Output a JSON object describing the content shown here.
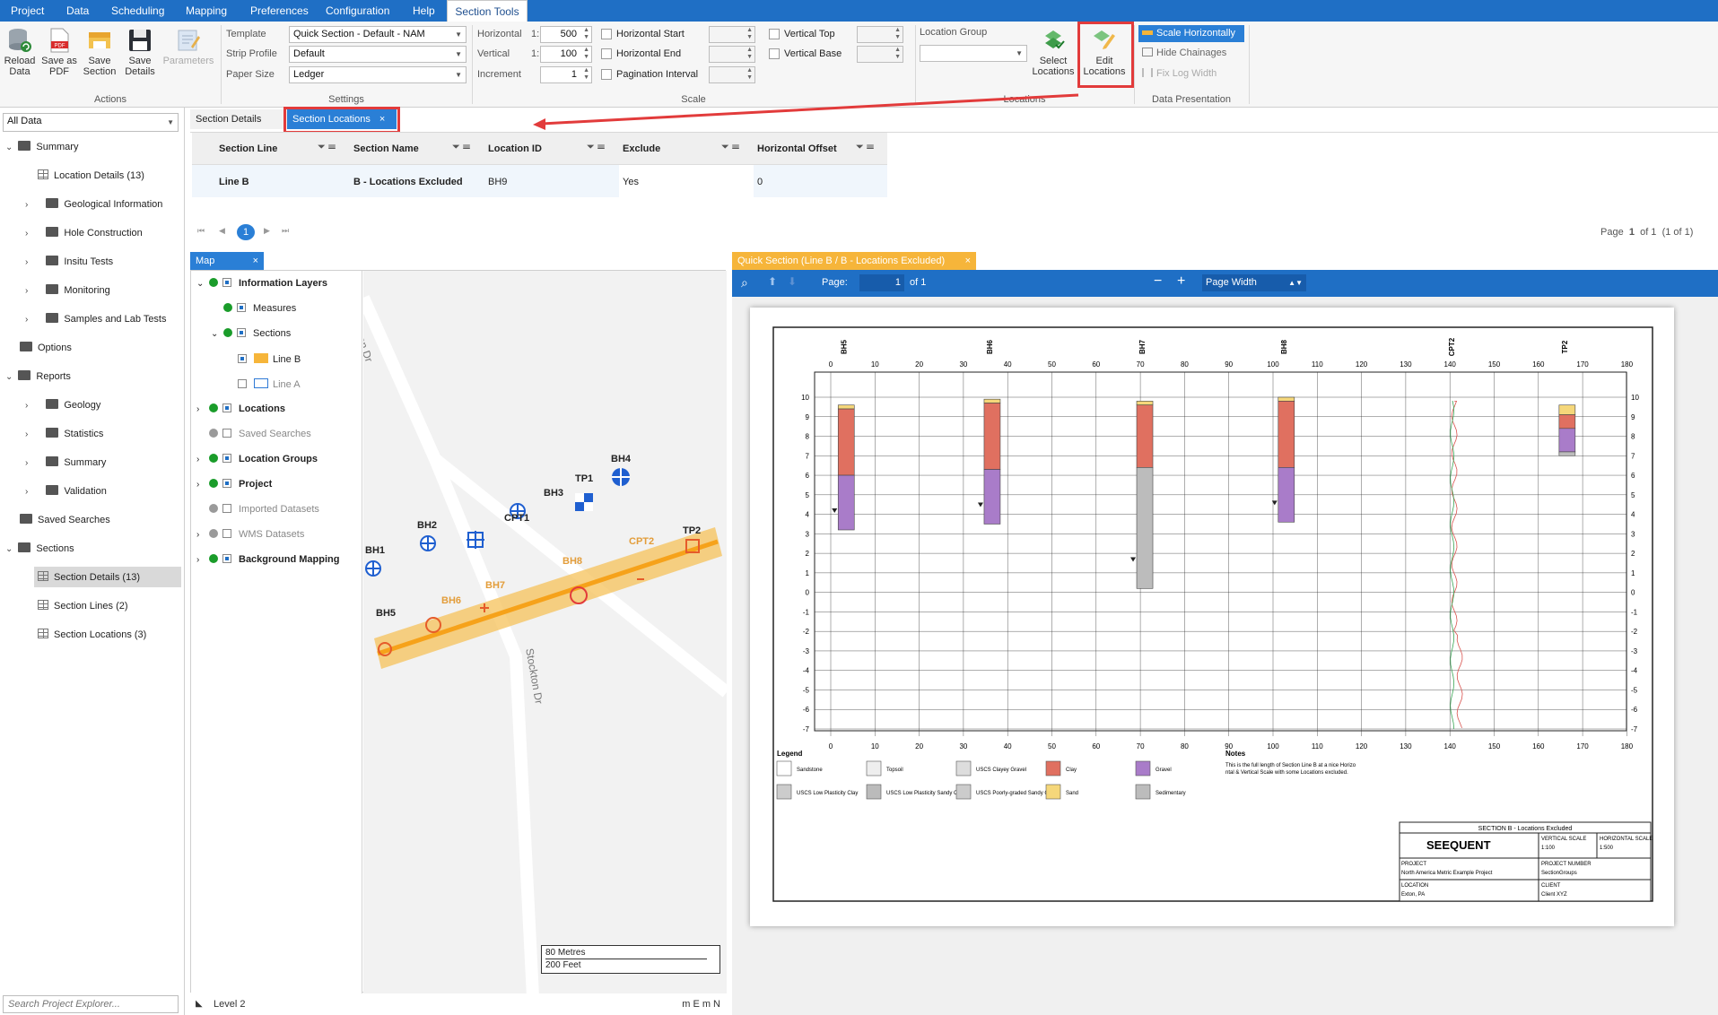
{
  "menu": [
    "Project",
    "Data",
    "Scheduling",
    "Mapping",
    "Preferences",
    "Configuration",
    "Help",
    "Section Tools"
  ],
  "ribbon": {
    "actions": {
      "reload": "Reload Data",
      "save_pdf": "Save as PDF",
      "save_section": "Save Section",
      "save_details": "Save Details",
      "parameters": "Parameters",
      "group": "Actions"
    },
    "settings": {
      "template_label": "Template",
      "template_value": "Quick Section - Default - NAM",
      "strip_label": "Strip Profile",
      "strip_value": "Default",
      "paper_label": "Paper Size",
      "paper_value": "Ledger",
      "group": "Settings"
    },
    "scale": {
      "horizontal_label": "Horizontal",
      "horizontal_value": "500",
      "vertical_label": "Vertical",
      "vertical_value": "100",
      "increment_label": "Increment",
      "increment_value": "1",
      "ratio_prefix": "1:",
      "h_start": "Horizontal Start",
      "h_end": "Horizontal End",
      "pagination": "Pagination Interval",
      "v_top": "Vertical Top",
      "v_base": "Vertical Base",
      "group": "Scale"
    },
    "locations": {
      "group_label": "Location Group",
      "select": "Select Locations",
      "edit": "Edit Locations",
      "group": "Locations"
    },
    "presentation": {
      "scale_h": "Scale Horizontally",
      "hide_chainages": "Hide Chainages",
      "fix_log": "Fix Log Width",
      "group": "Data Presentation"
    }
  },
  "explorer": {
    "dropdown": "All Data",
    "search_placeholder": "Search Project Explorer...",
    "items": [
      {
        "label": "Summary",
        "type": "folder",
        "level": 0,
        "exp": "v"
      },
      {
        "label": "Location Details (13)",
        "type": "grid",
        "level": 1,
        "exp": ""
      },
      {
        "label": "Geological Information",
        "type": "folder",
        "level": 1,
        "exp": ">"
      },
      {
        "label": "Hole Construction",
        "type": "folder",
        "level": 1,
        "exp": ">"
      },
      {
        "label": "Insitu Tests",
        "type": "folder",
        "level": 1,
        "exp": ">"
      },
      {
        "label": "Monitoring",
        "type": "folder",
        "level": 1,
        "exp": ">"
      },
      {
        "label": "Samples and Lab Tests",
        "type": "folder",
        "level": 1,
        "exp": ">"
      },
      {
        "label": "Options",
        "type": "folder",
        "level": 0,
        "exp": ""
      },
      {
        "label": "Reports",
        "type": "folder",
        "level": 0,
        "exp": "v"
      },
      {
        "label": "Geology",
        "type": "folder",
        "level": 1,
        "exp": ">"
      },
      {
        "label": "Statistics",
        "type": "folder",
        "level": 1,
        "exp": ">"
      },
      {
        "label": "Summary",
        "type": "folder",
        "level": 1,
        "exp": ">"
      },
      {
        "label": "Validation",
        "type": "folder",
        "level": 1,
        "exp": ">"
      },
      {
        "label": "Saved Searches",
        "type": "folder",
        "level": 0,
        "exp": ""
      },
      {
        "label": "Sections",
        "type": "folder",
        "level": 0,
        "exp": "v"
      },
      {
        "label": "Section Details (13)",
        "type": "grid",
        "level": 1,
        "exp": "",
        "selected": true
      },
      {
        "label": "Section Lines (2)",
        "type": "grid",
        "level": 1,
        "exp": ""
      },
      {
        "label": "Section Locations (3)",
        "type": "grid",
        "level": 1,
        "exp": ""
      }
    ]
  },
  "tabs": {
    "details": "Section Details",
    "locations": "Section Locations"
  },
  "grid": {
    "headers": [
      "Section Line",
      "Section Name",
      "Location ID",
      "Exclude",
      "Horizontal Offset"
    ],
    "row": [
      "Line B",
      "B - Locations Excluded",
      "BH9",
      "Yes",
      "0"
    ],
    "pager_page": "1",
    "page_label": "Page",
    "page_num": "1",
    "page_of": "of 1",
    "page_count": "(1 of 1)"
  },
  "map": {
    "tab": "Map",
    "layers": [
      {
        "label": "Information Layers",
        "bold": true,
        "dot": "#1a9c2a",
        "exp": "v",
        "indent": 0,
        "check": true
      },
      {
        "label": "Measures",
        "bold": false,
        "dot": "#1a9c2a",
        "exp": "",
        "indent": 1,
        "check": true
      },
      {
        "label": "Sections",
        "bold": false,
        "dot": "#1a9c2a",
        "exp": "v",
        "indent": 1,
        "check": true
      },
      {
        "label": "Line B",
        "bold": false,
        "dot": "",
        "exp": "",
        "indent": 2,
        "check": true,
        "swatch": "#f6b53a"
      },
      {
        "label": "Line A",
        "bold": false,
        "dot": "",
        "exp": "",
        "indent": 2,
        "check": false,
        "swatch": "#2f7ad6",
        "gray": true
      },
      {
        "label": "Locations",
        "bold": true,
        "dot": "#1a9c2a",
        "exp": ">",
        "indent": 0,
        "check": true
      },
      {
        "label": "Saved Searches",
        "bold": false,
        "dot": "#9a9a9a",
        "exp": "",
        "indent": 0,
        "check": false,
        "gray": true
      },
      {
        "label": "Location Groups",
        "bold": true,
        "dot": "#1a9c2a",
        "exp": ">",
        "indent": 0,
        "check": true
      },
      {
        "label": "Project",
        "bold": true,
        "dot": "#1a9c2a",
        "exp": ">",
        "indent": 0,
        "check": true
      },
      {
        "label": "Imported Datasets",
        "bold": false,
        "dot": "#9a9a9a",
        "exp": "",
        "indent": 0,
        "check": false,
        "gray": true
      },
      {
        "label": "WMS Datasets",
        "bold": false,
        "dot": "#9a9a9a",
        "exp": ">",
        "indent": 0,
        "check": false,
        "gray": true
      },
      {
        "label": "Background Mapping",
        "bold": true,
        "dot": "#1a9c2a",
        "exp": ">",
        "indent": 0,
        "check": true
      }
    ],
    "road": "Stockton Dr",
    "points": [
      "BH1",
      "BH2",
      "CPT1",
      "BH3",
      "TP1",
      "BH4",
      "TP2",
      "CPT2",
      "BH8",
      "BH7",
      "BH6",
      "BH5"
    ],
    "scale1": "80 Metres",
    "scale2": "200 Feet",
    "status": "Level 2",
    "units": "m E m N"
  },
  "section_view": {
    "tab": "Quick Section (Line B / B - Locations Excluded)",
    "page_label": "Page:",
    "page_value": "1",
    "page_of": "of 1",
    "zoom": "Page Width",
    "x_ticks": [
      "0",
      "10",
      "20",
      "30",
      "40",
      "50",
      "60",
      "70",
      "80",
      "90",
      "100",
      "110",
      "120",
      "130",
      "140",
      "150",
      "160",
      "170",
      "180"
    ],
    "y_ticks": [
      "10",
      "9",
      "8",
      "7",
      "6",
      "5",
      "4",
      "3",
      "2",
      "1",
      "0",
      "-1",
      "-2",
      "-3",
      "-4",
      "-5",
      "-6",
      "-7"
    ],
    "boreholes": [
      "BH5",
      "BH6",
      "BH7",
      "BH8",
      "CPT2",
      "TP2"
    ],
    "legend_title": "Legend",
    "legend": [
      "Sandstone",
      "Topsoil",
      "USCS Clayey Gravel",
      "Clay",
      "Gravel",
      "USCS Low Plasticity Clay",
      "USCS Low Plasticity Sandy Clay",
      "USCS Poorly-graded Sandy Gravel",
      "Sand",
      "Sedimentary"
    ],
    "notes_title": "Notes",
    "notes": "This is the full length of Section Line B at a nice Horizontal & Vertical Scale with some Locations excluded.",
    "titleblock": {
      "title": "SECTION B - Locations Excluded",
      "logo": "SEEQUENT",
      "vs_label": "VERTICAL SCALE",
      "vs": "1:100",
      "hs_label": "HORIZONTAL SCALE",
      "hs": "1:500",
      "project_label": "PROJECT",
      "project": "North America Metric Example Project",
      "pn_label": "PROJECT NUMBER",
      "pn": "SectionGroups",
      "loc_label": "LOCATION",
      "loc": "Exton, PA",
      "client_label": "CLIENT",
      "client": "Client XYZ"
    }
  },
  "colors": {
    "accent": "#1f6fc5",
    "highlight": "#e23b3b",
    "orange": "#f6b53a",
    "clay": "#e07060",
    "gravel": "#a97cc9",
    "sed": "#bcbcbc",
    "sand": "#f5d77a"
  }
}
